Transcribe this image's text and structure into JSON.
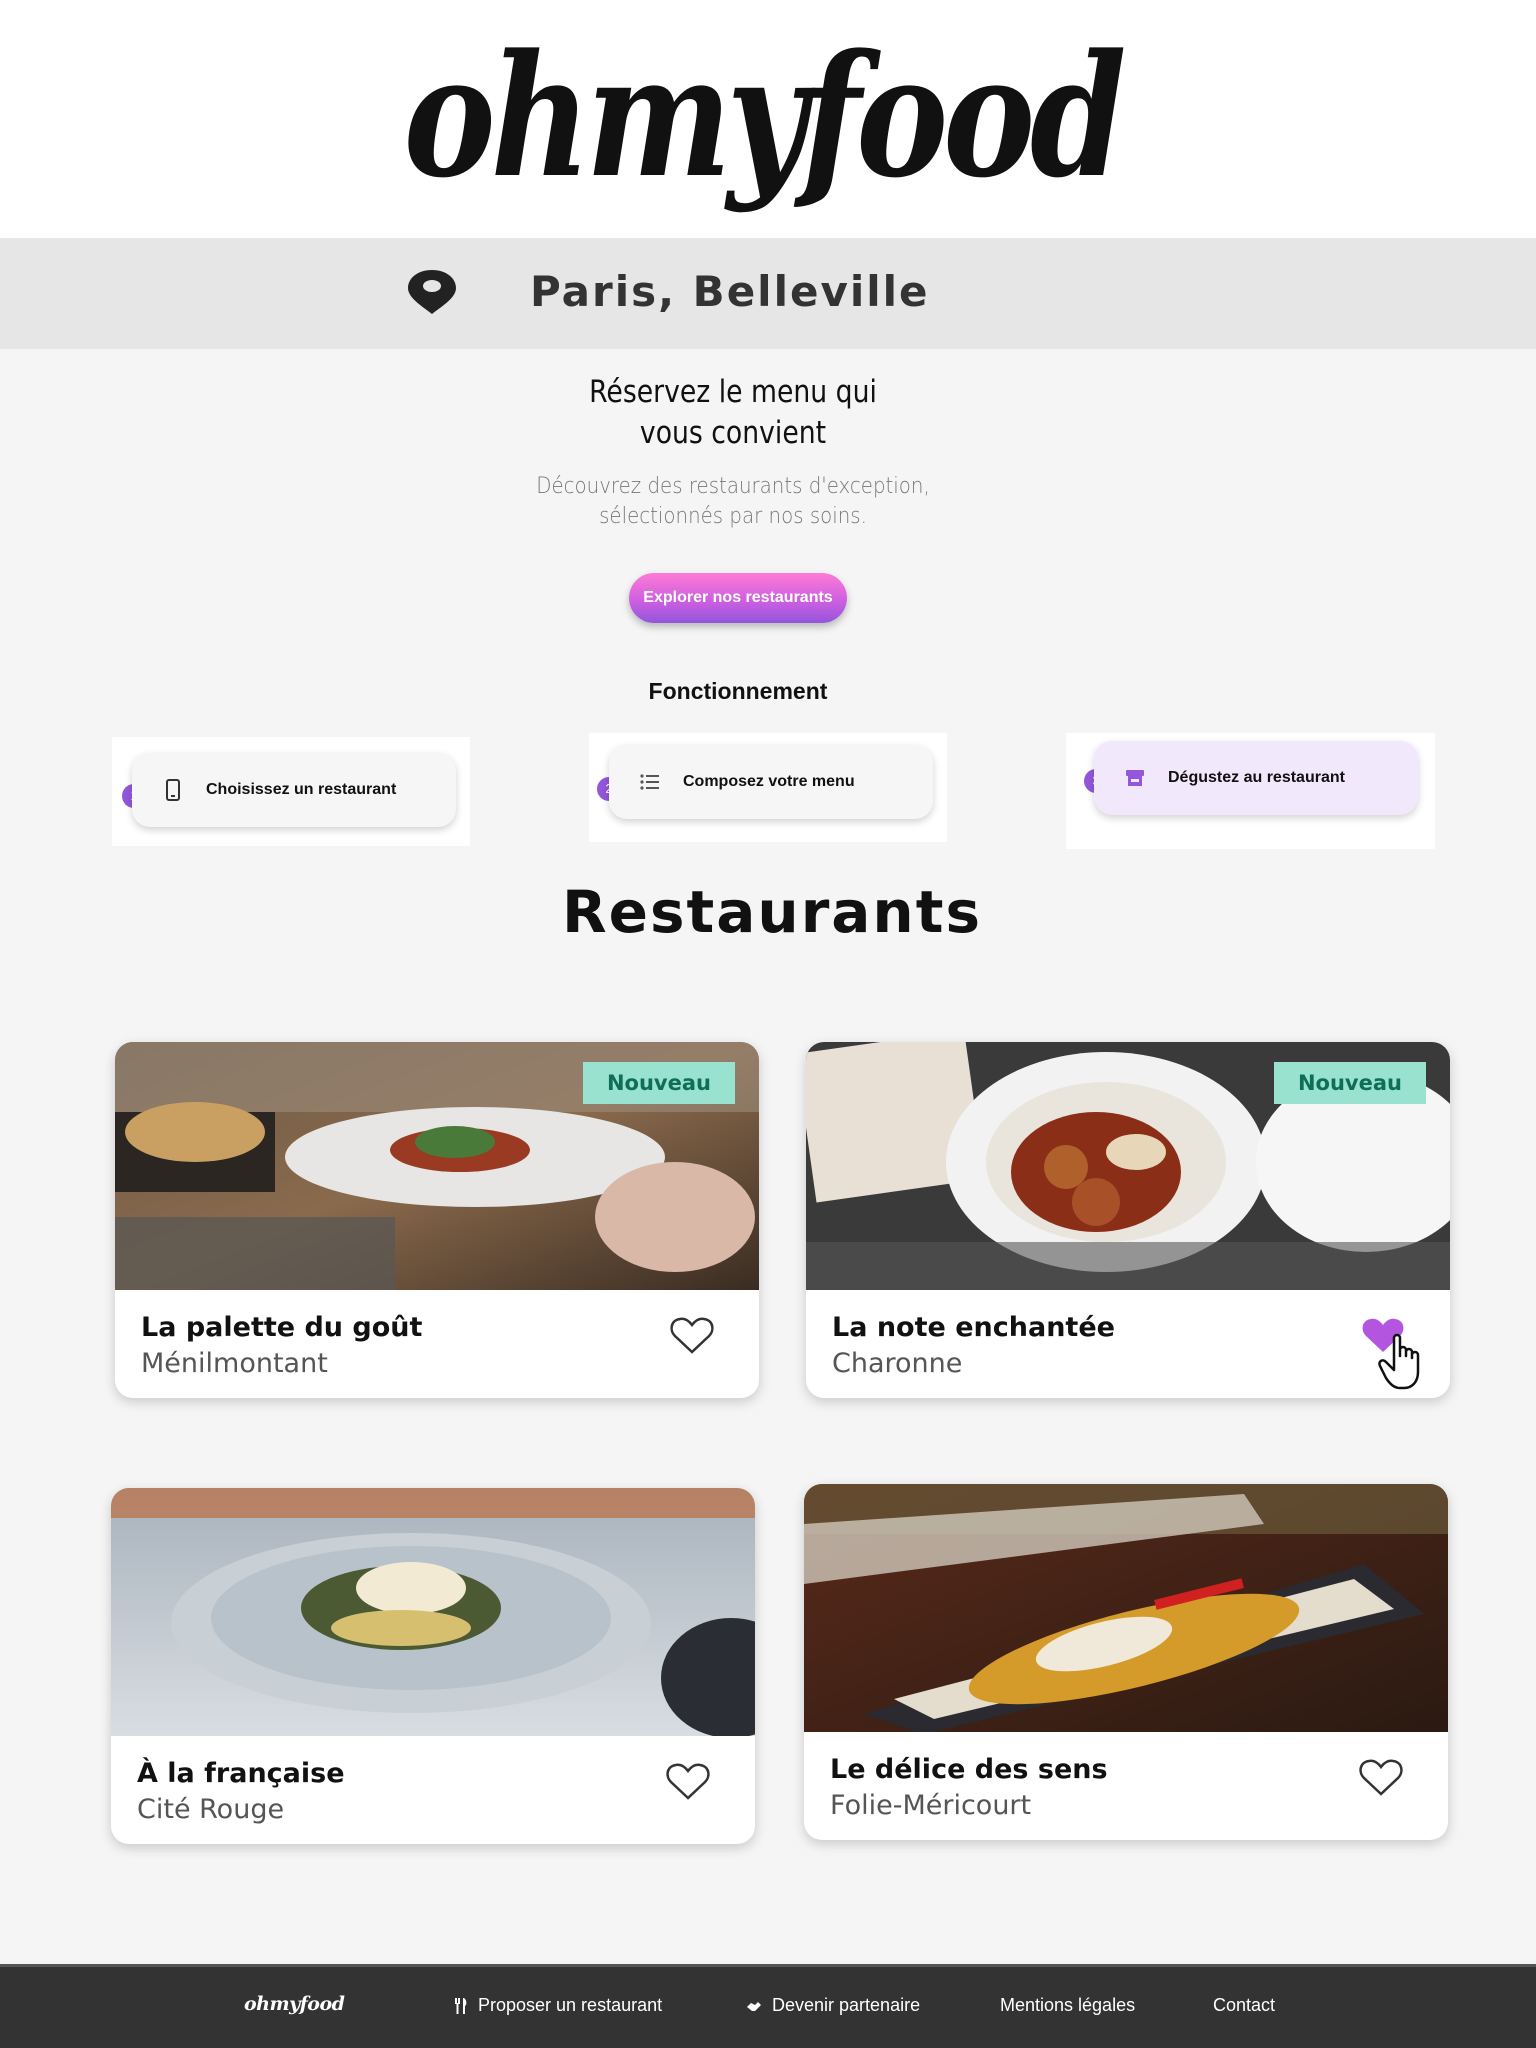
{
  "header": {
    "logo": "ohmyfood"
  },
  "location": {
    "text": "Paris, Belleville",
    "icon": "location-pin-icon"
  },
  "hero": {
    "title_line1": "Réservez le menu qui",
    "title_line2": "vous convient",
    "subtitle_line1": "Découvrez des restaurants d'exception,",
    "subtitle_line2": "sélectionnés par nos soins.",
    "cta": "Explorer nos restaurants"
  },
  "how": {
    "title": "Fonctionnement",
    "steps": [
      {
        "number": "1",
        "label": "Choisissez un restaurant",
        "icon": "smartphone-icon"
      },
      {
        "number": "2",
        "label": "Composez votre menu",
        "icon": "list-icon"
      },
      {
        "number": "3",
        "label": "Dégustez au restaurant",
        "icon": "store-icon"
      }
    ]
  },
  "restaurants": {
    "title": "Restaurants",
    "items": [
      {
        "name": "La palette du goût",
        "area": "Ménilmontant",
        "badge": "Nouveau",
        "liked": false
      },
      {
        "name": "La note enchantée",
        "area": "Charonne",
        "badge": "Nouveau",
        "liked": true
      },
      {
        "name": "À la française",
        "area": "Cité Rouge",
        "badge": "",
        "liked": false
      },
      {
        "name": "Le délice des sens",
        "area": "Folie-Méricourt",
        "badge": "",
        "liked": false
      }
    ]
  },
  "footer": {
    "logo": "ohmyfood",
    "links": [
      {
        "label": "Proposer un restaurant",
        "icon": "utensils-icon"
      },
      {
        "label": "Devenir partenaire",
        "icon": "handshake-icon"
      },
      {
        "label": "Mentions légales"
      },
      {
        "label": "Contact"
      }
    ]
  },
  "colors": {
    "accent": "#9356dc",
    "accent_pink": "#ff7ad6",
    "badge_bg": "#99e2d0",
    "badge_text": "#0f6e56",
    "footer_bg": "#333333"
  }
}
